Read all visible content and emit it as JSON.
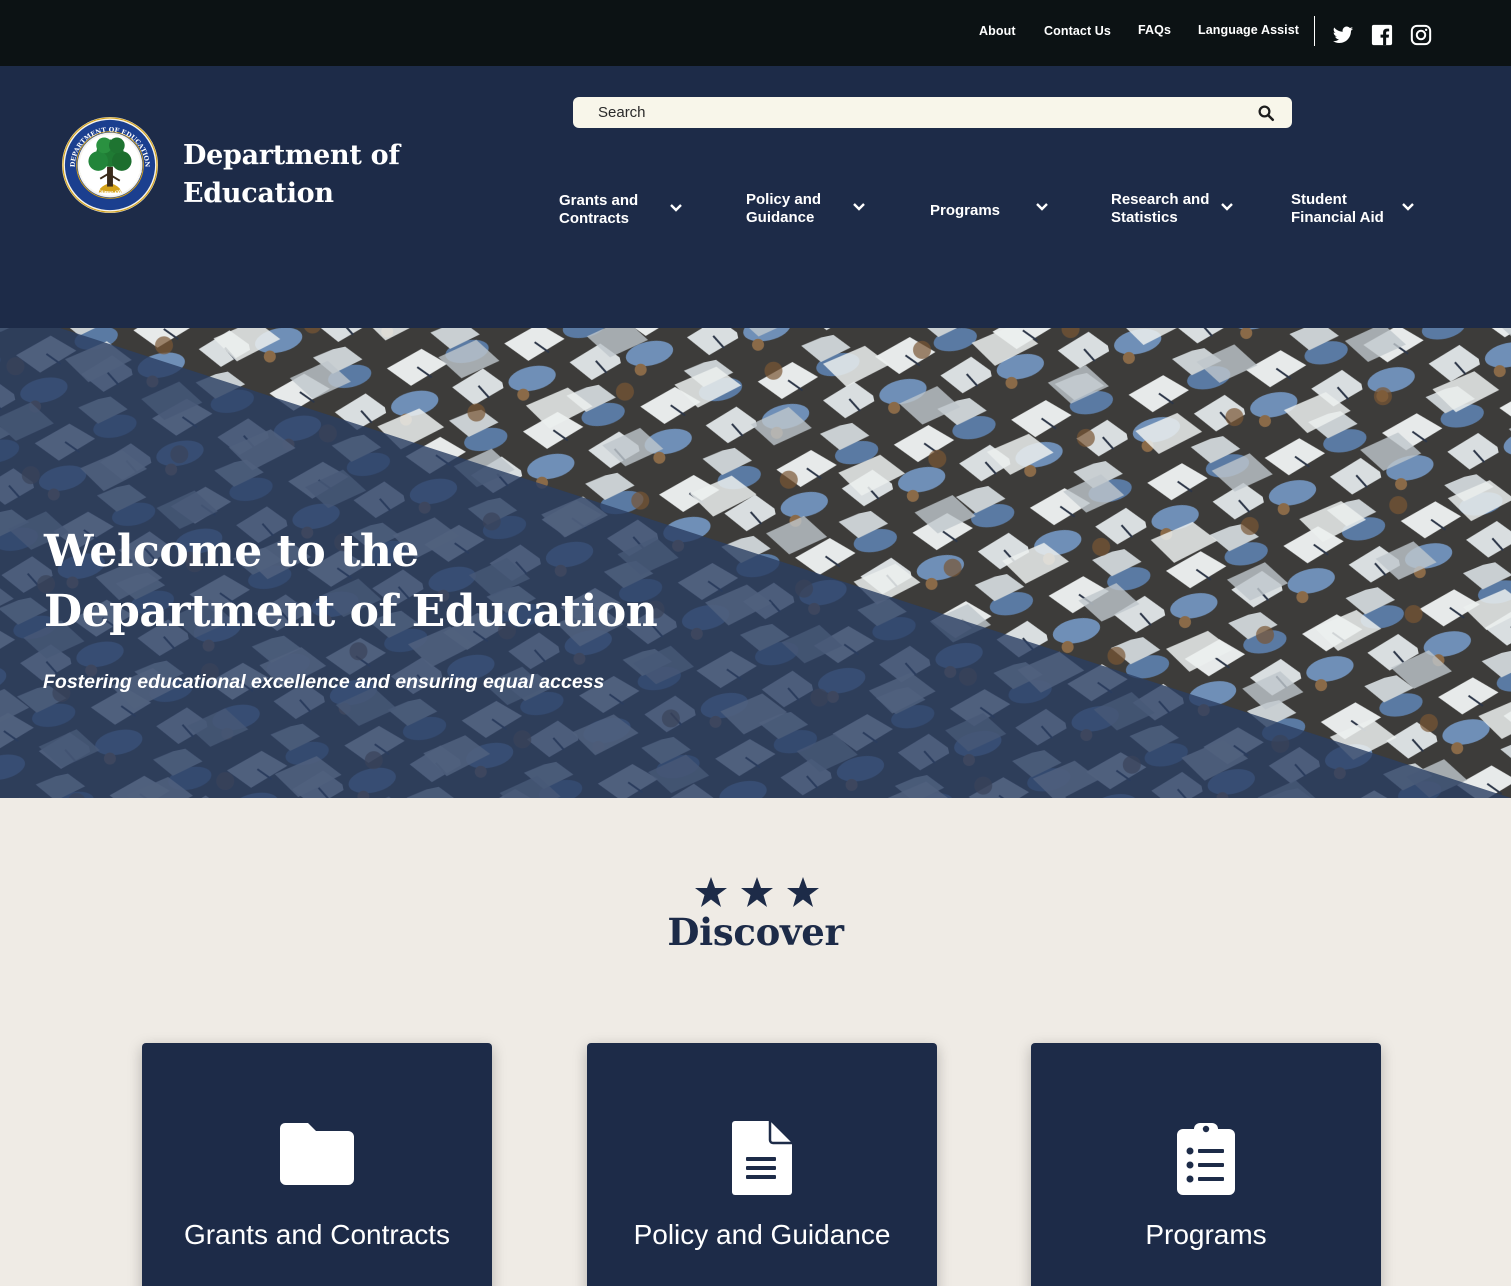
{
  "utility_nav": {
    "links": [
      "About",
      "Contact Us",
      "FAQs",
      "Language Assist"
    ],
    "social": [
      "twitter-icon",
      "facebook-icon",
      "instagram-icon"
    ]
  },
  "header": {
    "site_title": "Department of Education",
    "seal_icon": "department-seal-icon",
    "search_placeholder": "Search",
    "nav": [
      {
        "label": "Grants and Contracts"
      },
      {
        "label": "Policy and Guidance"
      },
      {
        "label": "Programs"
      },
      {
        "label": "Research and Statistics"
      },
      {
        "label": "Student Financial Aid"
      }
    ]
  },
  "hero": {
    "title": "Welcome to the Department of Education",
    "subtitle": "Fostering educational excellence and ensuring equal access"
  },
  "discover": {
    "title": "Discover",
    "cards": [
      {
        "title": "Grants and Contracts",
        "icon": "folder-icon"
      },
      {
        "title": "Policy and Guidance",
        "icon": "document-icon"
      },
      {
        "title": "Programs",
        "icon": "clipboard-list-icon"
      }
    ]
  },
  "colors": {
    "navy": "#1d2b48",
    "utility_bar": "#0c1214",
    "search_bg": "#f8f6ea",
    "page_bg": "#efebe5"
  }
}
